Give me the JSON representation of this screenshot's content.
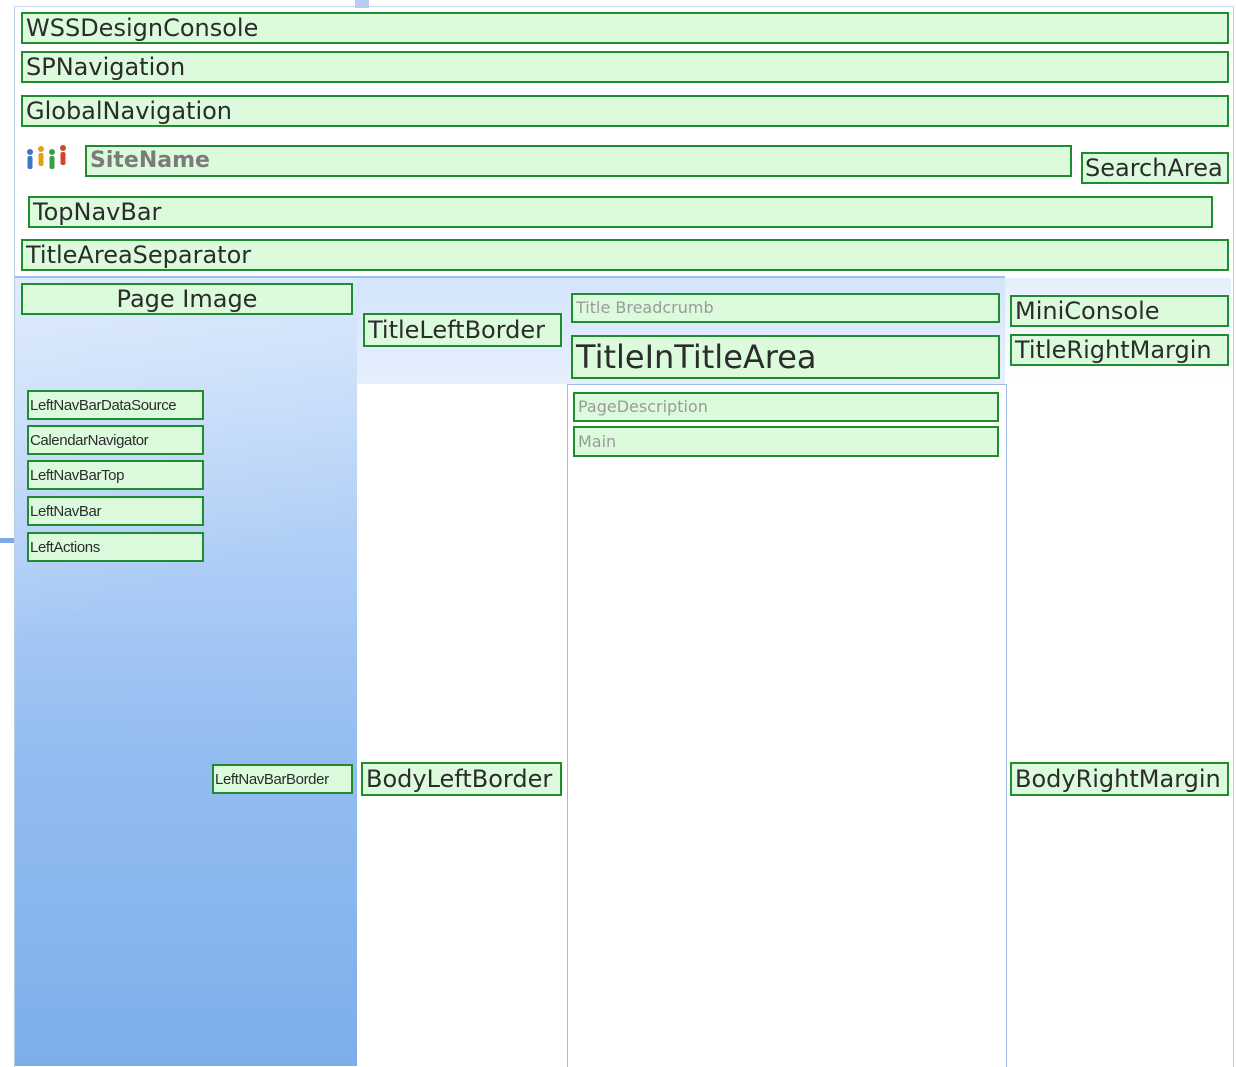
{
  "regions": {
    "wss_design_console": "WSSDesignConsole",
    "sp_navigation": "SPNavigation",
    "global_navigation": "GlobalNavigation",
    "site_name": "SiteName",
    "search_area": "SearchArea",
    "top_nav_bar": "TopNavBar",
    "title_area_separator": "TitleAreaSeparator",
    "page_image": "Page Image",
    "title_left_border": "TitleLeftBorder",
    "title_breadcrumb": "Title Breadcrumb",
    "title_in_title_area": "TitleInTitleArea",
    "mini_console": "MiniConsole",
    "title_right_margin": "TitleRightMargin",
    "left_nav_bar_data_source": "LeftNavBarDataSource",
    "calendar_navigator": "CalendarNavigator",
    "left_nav_bar_top": "LeftNavBarTop",
    "left_nav_bar": "LeftNavBar",
    "left_actions": "LeftActions",
    "page_description": "PageDescription",
    "main": "Main",
    "left_nav_bar_border": "LeftNavBarBorder",
    "body_left_border": "BodyLeftBorder",
    "body_right_margin": "BodyRightMargin"
  },
  "icons": {
    "site_logo": "people-icon"
  },
  "colors": {
    "box_border": "#1f8c2f",
    "box_fill": "#dcfbdc",
    "left_column_blue": "#7daeeb",
    "title_band_blue": "#d3e5fc"
  }
}
